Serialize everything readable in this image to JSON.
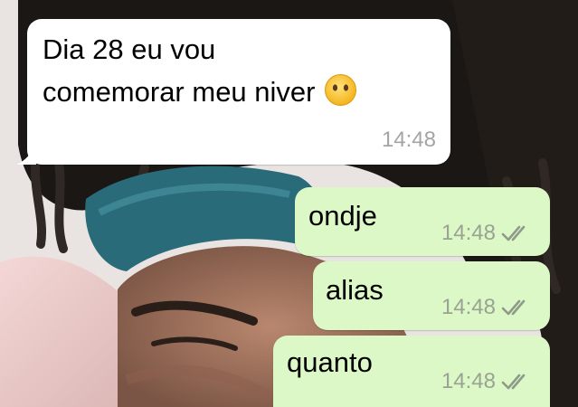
{
  "chat": {
    "messages": [
      {
        "direction": "incoming",
        "text_line1": "Dia 28 eu vou",
        "text_line2": "comemorar meu niver",
        "emoji": "neutral-face-no-mouth",
        "time": "14:48"
      },
      {
        "direction": "outgoing",
        "text": "ondje",
        "time": "14:48",
        "status": "read-double-check"
      },
      {
        "direction": "outgoing",
        "text": "alias",
        "time": "14:48",
        "status": "read-double-check"
      },
      {
        "direction": "outgoing",
        "text": "quanto",
        "time": "14:48",
        "status": "read-double-check"
      }
    ]
  },
  "colors": {
    "incoming_bubble": "#ffffff",
    "outgoing_bubble": "#dcf8c6",
    "timestamp": "#9aa294",
    "ticks": "#8f9a8a"
  }
}
